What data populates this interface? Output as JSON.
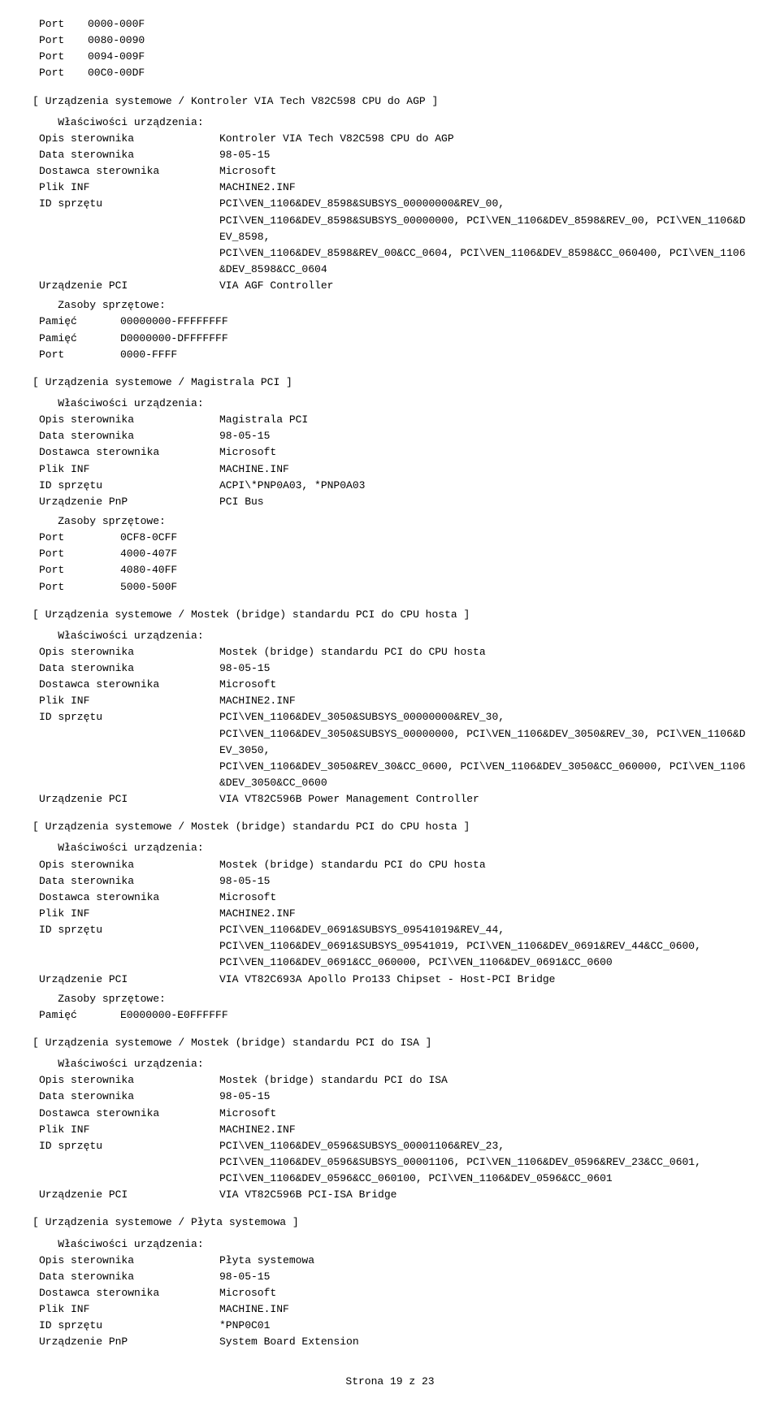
{
  "page": {
    "footer": "Strona 19 z 23"
  },
  "sections": [
    {
      "id": "ports-top",
      "type": "ports",
      "ports": [
        {
          "label": "Port",
          "value": "0000-000F"
        },
        {
          "label": "Port",
          "value": "0080-0090"
        },
        {
          "label": "Port",
          "value": "0094-009F"
        },
        {
          "label": "Port",
          "value": "00C0-00DF"
        }
      ]
    },
    {
      "id": "via-agp",
      "type": "device-section",
      "header": "[ Urządzenia systemowe / Kontroler VIA Tech V82C598 CPU do AGP ]",
      "properties_label": "Właściwości urządzenia:",
      "properties": [
        {
          "label": "Opis sterownika",
          "value": "Kontroler VIA Tech V82C598 CPU do AGP"
        },
        {
          "label": "Data sterownika",
          "value": "98-05-15"
        },
        {
          "label": "Dostawca sterownika",
          "value": "Microsoft"
        },
        {
          "label": "Plik INF",
          "value": "MACHINE2.INF"
        },
        {
          "label": "ID sprzętu",
          "value": "PCI\\VEN_1106&DEV_8598&SUBSYS_00000000&REV_00,\nPCI\\VEN_1106&DEV_8598&SUBSYS_00000000, PCI\\VEN_1106&DEV_8598&REV_00, PCI\\VEN_1106&DEV_8598,\nPCI\\VEN_1106&DEV_8598&REV_00&CC_0604, PCI\\VEN_1106&DEV_8598&CC_060400, PCI\\VEN_1106&DEV_8598&CC_0604"
        },
        {
          "label": "Urządzenie PCI",
          "value": "VIA AGF Controller"
        }
      ],
      "resources_label": "Zasoby sprzętowe:",
      "resources": [
        {
          "label": "Pamięć",
          "value": "00000000-FFFFFFFF"
        },
        {
          "label": "Pamięć",
          "value": "D0000000-DFFFFFFF"
        },
        {
          "label": "Port",
          "value": "0000-FFFF"
        }
      ]
    },
    {
      "id": "magistrala-pci",
      "type": "device-section",
      "header": "[ Urządzenia systemowe / Magistrala PCI ]",
      "properties_label": "Właściwości urządzenia:",
      "properties": [
        {
          "label": "Opis sterownika",
          "value": "Magistrala PCI"
        },
        {
          "label": "Data sterownika",
          "value": "98-05-15"
        },
        {
          "label": "Dostawca sterownika",
          "value": "Microsoft"
        },
        {
          "label": "Plik INF",
          "value": "MACHINE.INF"
        },
        {
          "label": "ID sprzętu",
          "value": "ACPI\\*PNP0A03, *PNP0A03"
        },
        {
          "label": "Urządzenie PnP",
          "value": "PCI Bus"
        }
      ],
      "resources_label": "Zasoby sprzętowe:",
      "resources": [
        {
          "label": "Port",
          "value": "0CF8-0CFF"
        },
        {
          "label": "Port",
          "value": "4000-407F"
        },
        {
          "label": "Port",
          "value": "4080-40FF"
        },
        {
          "label": "Port",
          "value": "5000-500F"
        }
      ]
    },
    {
      "id": "mostek-cpu-1",
      "type": "device-section",
      "header": "[ Urządzenia systemowe / Mostek (bridge) standardu PCI do CPU hosta ]",
      "properties_label": "Właściwości urządzenia:",
      "properties": [
        {
          "label": "Opis sterownika",
          "value": "Mostek (bridge) standardu PCI do CPU hosta"
        },
        {
          "label": "Data sterownika",
          "value": "98-05-15"
        },
        {
          "label": "Dostawca sterownika",
          "value": "Microsoft"
        },
        {
          "label": "Plik INF",
          "value": "MACHINE2.INF"
        },
        {
          "label": "ID sprzętu",
          "value": "PCI\\VEN_1106&DEV_3050&SUBSYS_00000000&REV_30,\nPCI\\VEN_1106&DEV_3050&SUBSYS_00000000, PCI\\VEN_1106&DEV_3050&REV_30, PCI\\VEN_1106&DEV_3050,\nPCI\\VEN_1106&DEV_3050&REV_30&CC_0600, PCI\\VEN_1106&DEV_3050&CC_060000, PCI\\VEN_1106&DEV_3050&CC_0600"
        },
        {
          "label": "Urządzenie PCI",
          "value": "VIA VT82C596B Power Management Controller"
        }
      ],
      "resources_label": null,
      "resources": []
    },
    {
      "id": "mostek-cpu-2",
      "type": "device-section",
      "header": "[ Urządzenia systemowe / Mostek (bridge) standardu PCI do CPU hosta ]",
      "properties_label": "Właściwości urządzenia:",
      "properties": [
        {
          "label": "Opis sterownika",
          "value": "Mostek (bridge) standardu PCI do CPU hosta"
        },
        {
          "label": "Data sterownika",
          "value": "98-05-15"
        },
        {
          "label": "Dostawca sterownika",
          "value": "Microsoft"
        },
        {
          "label": "Plik INF",
          "value": "MACHINE2.INF"
        },
        {
          "label": "ID sprzętu",
          "value": "PCI\\VEN_1106&DEV_0691&SUBSYS_09541019&REV_44,\nPCI\\VEN_1106&DEV_0691&SUBSYS_09541019, PCI\\VEN_1106&DEV_0691&REV_44&CC_0600,\nPCI\\VEN_1106&DEV_0691&CC_060000, PCI\\VEN_1106&DEV_0691&CC_0600"
        },
        {
          "label": "Urządzenie PCI",
          "value": "VIA VT82C693A Apollo Pro133 Chipset - Host-PCI Bridge"
        }
      ],
      "resources_label": "Zasoby sprzętowe:",
      "resources": [
        {
          "label": "Pamięć",
          "value": "E0000000-E0FFFFFF"
        }
      ]
    },
    {
      "id": "mostek-isa",
      "type": "device-section",
      "header": "[ Urządzenia systemowe / Mostek (bridge) standardu PCI do ISA ]",
      "properties_label": "Właściwości urządzenia:",
      "properties": [
        {
          "label": "Opis sterownika",
          "value": "Mostek (bridge) standardu PCI do ISA"
        },
        {
          "label": "Data sterownika",
          "value": "98-05-15"
        },
        {
          "label": "Dostawca sterownika",
          "value": "Microsoft"
        },
        {
          "label": "Plik INF",
          "value": "MACHINE2.INF"
        },
        {
          "label": "ID sprzętu",
          "value": "PCI\\VEN_1106&DEV_0596&SUBSYS_00001106&REV_23,\nPCI\\VEN_1106&DEV_0596&SUBSYS_00001106, PCI\\VEN_1106&DEV_0596&REV_23&CC_0601,\nPCI\\VEN_1106&DEV_0596&CC_060100, PCI\\VEN_1106&DEV_0596&CC_0601"
        },
        {
          "label": "Urządzenie PCI",
          "value": "VIA VT82C596B PCI-ISA Bridge"
        }
      ],
      "resources_label": null,
      "resources": []
    },
    {
      "id": "plyta-systemowa",
      "type": "device-section",
      "header": "[ Urządzenia systemowe / Płyta systemowa ]",
      "properties_label": "Właściwości urządzenia:",
      "properties": [
        {
          "label": "Opis sterownika",
          "value": "Płyta systemowa"
        },
        {
          "label": "Data sterownika",
          "value": "98-05-15"
        },
        {
          "label": "Dostawca sterownika",
          "value": "Microsoft"
        },
        {
          "label": "Plik INF",
          "value": "MACHINE.INF"
        },
        {
          "label": "ID sprzętu",
          "value": "*PNP0C01"
        },
        {
          "label": "Urządzenie PnP",
          "value": "System Board Extension"
        }
      ],
      "resources_label": null,
      "resources": []
    }
  ]
}
